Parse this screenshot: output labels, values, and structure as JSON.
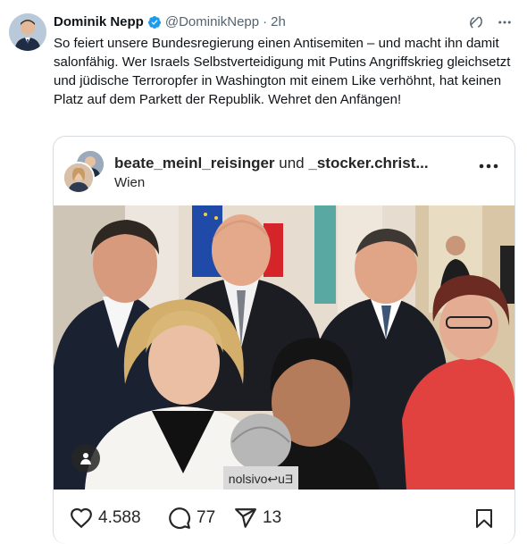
{
  "tweet": {
    "author_name": "Dominik Nepp",
    "handle": "@DominikNepp",
    "separator": "·",
    "time": "2h",
    "text": "So feiert unsere Bundesregierung einen Antisemiten – und macht ihn damit salonfähig. Wer Israels Selbstverteidigung mit Putins Angriffskrieg gleichsetzt und jüdische Terroropfer in Washington mit einem Like verhöhnt, hat keinen Platz auf dem Parkett der Republik. Wehret den Anfängen!"
  },
  "instagram_post": {
    "user1": "beate_meinl_reisinger",
    "connector": "und",
    "user2": "_stocker.christ...",
    "location": "Wien",
    "likes": "4.588",
    "comments": "77",
    "shares": "13",
    "mic_brand_text": "nolsivo↩uƎ"
  },
  "colors": {
    "verified_blue": "#1d9bf0",
    "secondary_text": "#536471",
    "text": "#0f1419"
  }
}
